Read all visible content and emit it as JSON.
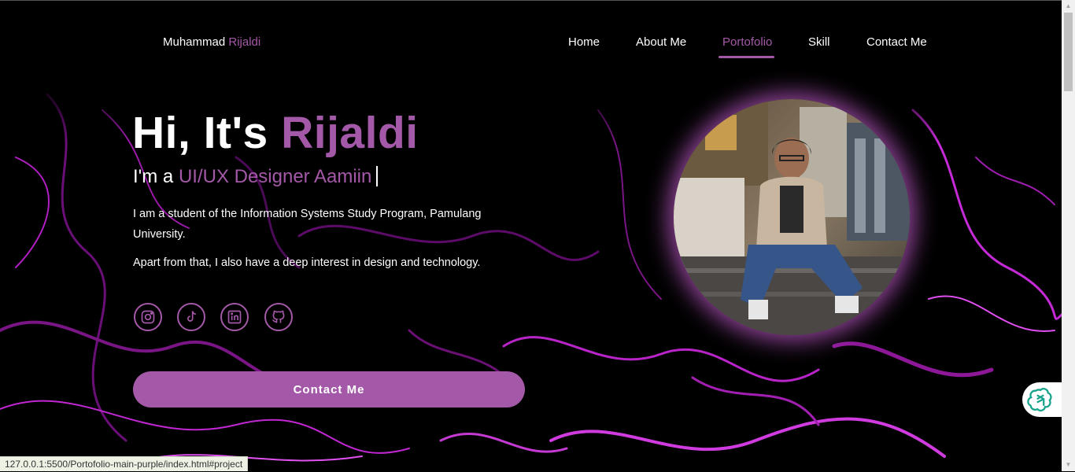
{
  "brand": {
    "first": "Muhammad",
    "last": "Rijaldi"
  },
  "nav": {
    "items": [
      {
        "label": "Home",
        "active": false
      },
      {
        "label": "About Me",
        "active": false
      },
      {
        "label": "Portofolio",
        "active": true
      },
      {
        "label": "Skill",
        "active": false
      },
      {
        "label": "Contact Me",
        "active": false
      }
    ]
  },
  "hero": {
    "greeting": "Hi, It's ",
    "name": "Rijaldi",
    "subtitle_prefix": "I'm a ",
    "subtitle_role": "UI/UX Designer Aamiin",
    "desc1": "I am a student of the Information Systems Study Program, Pamulang University.",
    "desc2": "Apart from that, I also have a deep interest in design and technology.",
    "cta_label": "Contact Me"
  },
  "social": [
    {
      "icon": "instagram-icon"
    },
    {
      "icon": "tiktok-icon"
    },
    {
      "icon": "linkedin-icon"
    },
    {
      "icon": "github-icon"
    }
  ],
  "status_url": "127.0.0.1:5500/Portofolio-main-purple/index.html#project",
  "colors": {
    "accent": "#a459a8",
    "background": "#000000"
  }
}
